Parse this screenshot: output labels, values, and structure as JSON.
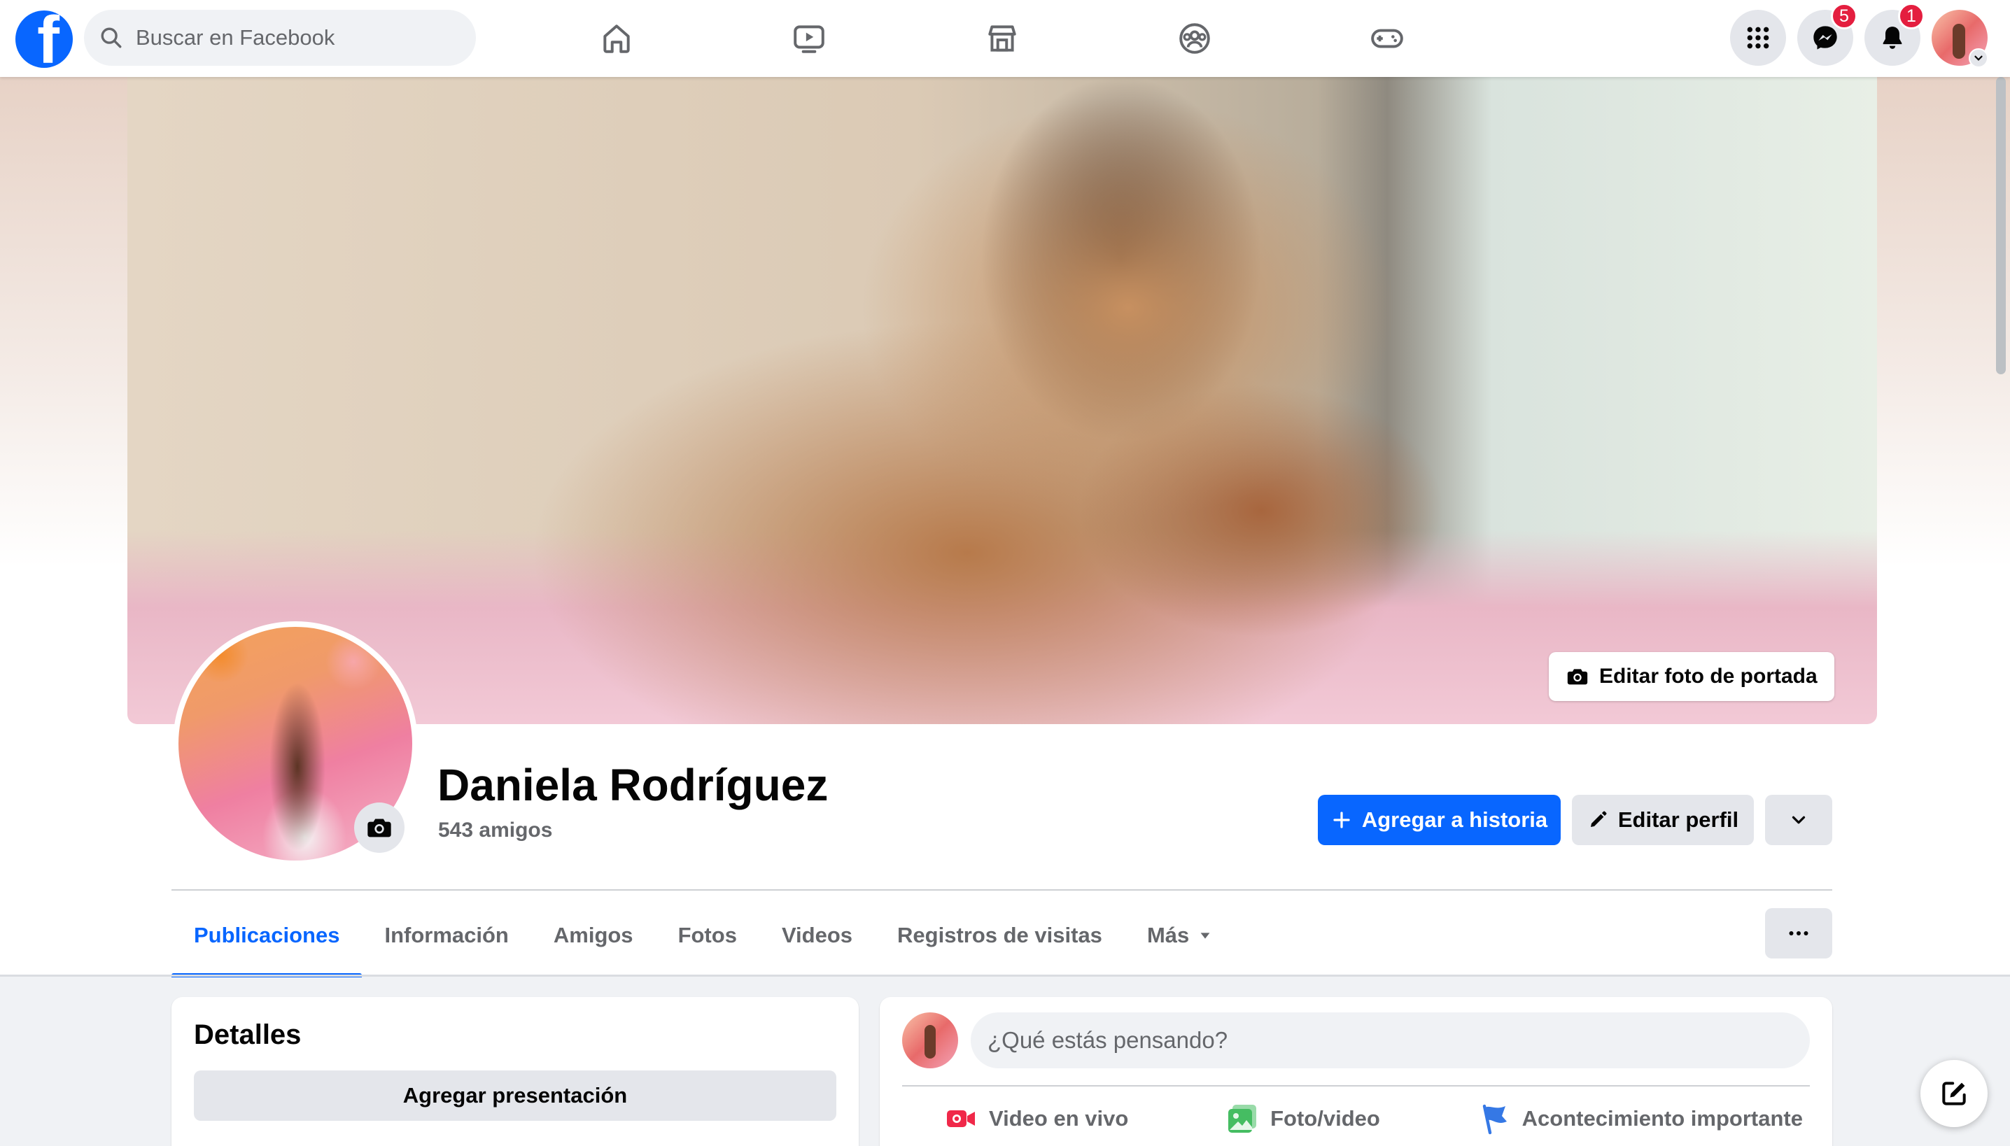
{
  "search": {
    "placeholder": "Buscar en Facebook"
  },
  "nav": [
    {
      "name": "home-icon"
    },
    {
      "name": "video-icon"
    },
    {
      "name": "marketplace-icon"
    },
    {
      "name": "groups-icon"
    },
    {
      "name": "gaming-icon"
    }
  ],
  "notifications": {
    "messenger_badge": "5",
    "bell_badge": "1"
  },
  "cover": {
    "edit_label": "Editar foto de portada"
  },
  "profile": {
    "name": "Daniela Rodríguez",
    "friends": "543 amigos"
  },
  "actions": {
    "add_story": "Agregar a historia",
    "edit_profile": "Editar perfil"
  },
  "tabs": [
    {
      "label": "Publicaciones",
      "active": true
    },
    {
      "label": "Información"
    },
    {
      "label": "Amigos"
    },
    {
      "label": "Fotos"
    },
    {
      "label": "Videos"
    },
    {
      "label": "Registros de visitas"
    },
    {
      "label": "Más"
    }
  ],
  "details": {
    "title": "Detalles",
    "add_bio": "Agregar presentación"
  },
  "composer": {
    "placeholder": "¿Qué estás pensando?",
    "live": "Video en vivo",
    "photo": "Foto/video",
    "event": "Acontecimiento importante"
  },
  "colors": {
    "brand": "#0866ff",
    "badge": "#e41e3f",
    "live_red": "#f02849",
    "photo_green": "#45bd62",
    "event_blue": "#3578e5"
  }
}
